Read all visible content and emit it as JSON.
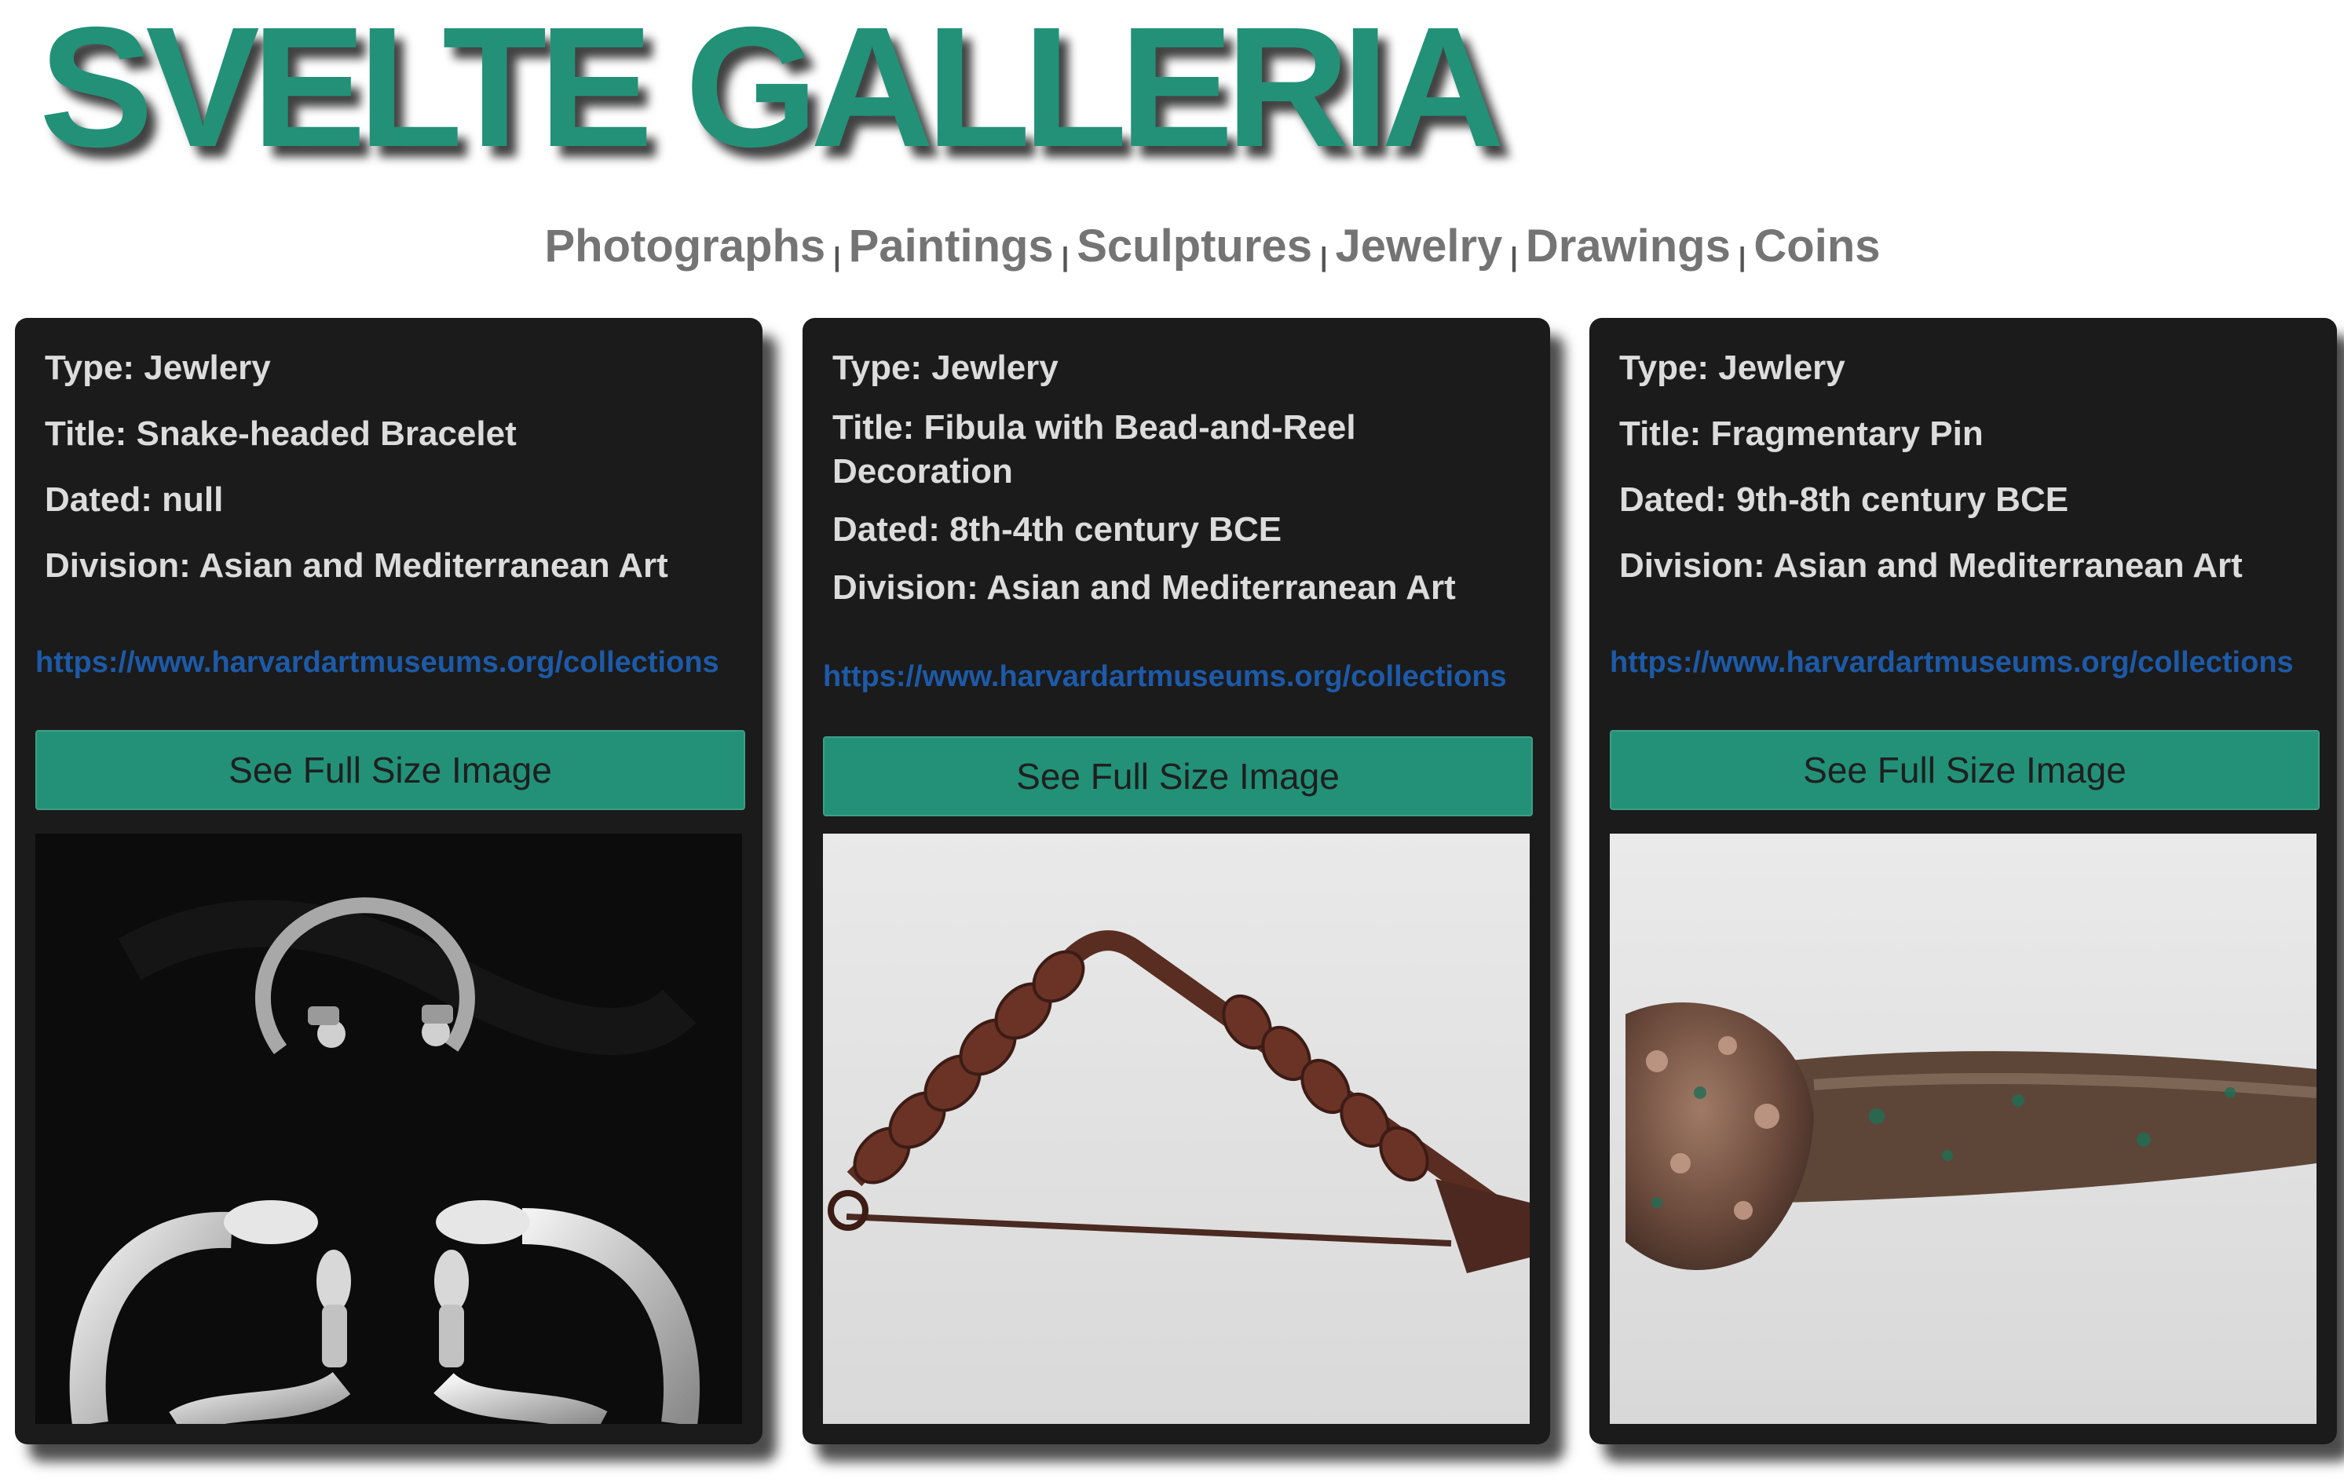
{
  "site": {
    "title": "SVELTE GALLERIA"
  },
  "nav": {
    "items": [
      "Photographs",
      "Paintings",
      "Sculptures",
      "Jewelry",
      "Drawings",
      "Coins"
    ],
    "separator": "|"
  },
  "cards": [
    {
      "type": "Type: Jewlery",
      "title": "Title: Snake-headed Bracelet",
      "dated": "Dated: null",
      "division": "Division: Asian and Mediterranean Art",
      "url": "https://www.harvardartmuseums.org/collections",
      "button": "See Full Size Image",
      "image": "silver snake-headed bracelets on black background"
    },
    {
      "type": "Type: Jewlery",
      "title": "Title: Fibula with Bead-and-Reel Decoration",
      "dated": "Dated: 8th-4th century BCE",
      "division": "Division: Asian and Mediterranean Art",
      "url": "https://www.harvardartmuseums.org/collections",
      "button": "See Full Size Image",
      "image": "bronze triangular fibula on light grey background"
    },
    {
      "type": "Type: Jewlery",
      "title": "Title: Fragmentary Pin",
      "dated": "Dated: 9th-8th century BCE",
      "division": "Division: Asian and Mediterranean Art",
      "url": "https://www.harvardartmuseums.org/collections",
      "button": "See Full Size Image",
      "image": "corroded bronze pin fragment on light grey background"
    }
  ],
  "colors": {
    "accent": "#229178",
    "card_bg": "#1b1b1b",
    "link": "#1d5aa8",
    "nav_text": "#747474"
  }
}
